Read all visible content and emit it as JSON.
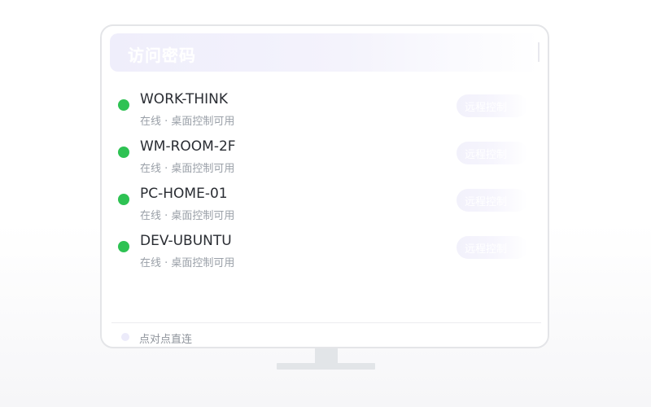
{
  "header": {
    "title": "访问密码"
  },
  "devices": [
    {
      "name": "WORK-THINK",
      "status": "在线 · 桌面控制可用",
      "action": "远程控制",
      "online": true
    },
    {
      "name": "WM-ROOM-2F",
      "status": "在线 · 桌面控制可用",
      "action": "远程控制",
      "online": true
    },
    {
      "name": "PC-HOME-01",
      "status": "在线 · 桌面控制可用",
      "action": "远程控制",
      "online": true
    },
    {
      "name": "DEV-UBUNTU",
      "status": "在线 · 桌面控制可用",
      "action": "远程控制",
      "online": true
    }
  ],
  "footer": {
    "label": "点对点直连"
  },
  "colors": {
    "online": "#2ec253",
    "accent_tint": "#efeefb"
  }
}
